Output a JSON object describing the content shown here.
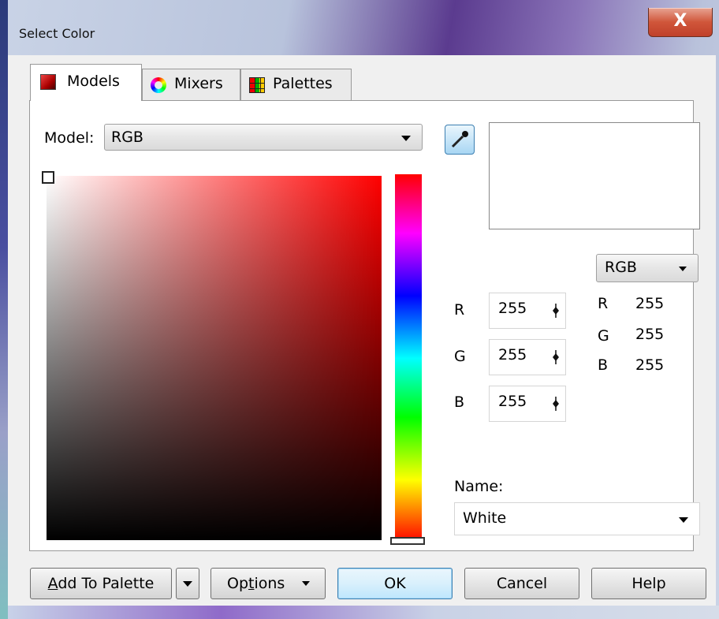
{
  "window": {
    "title": "Select Color",
    "close_glyph": "X"
  },
  "tabs": [
    {
      "label": "Models",
      "icon": "models-swatch-icon",
      "active": true
    },
    {
      "label": "Mixers",
      "icon": "mixers-ring-icon",
      "active": false
    },
    {
      "label": "Palettes",
      "icon": "palettes-grid-icon",
      "active": false
    }
  ],
  "model": {
    "label": "Model:",
    "value": "RGB"
  },
  "picker": {
    "hue": "red",
    "marker_icon": "crosshair-square-icon"
  },
  "eyedropper": {
    "icon": "eyedropper-icon"
  },
  "preview": {
    "color": "#ffffff"
  },
  "readout_model": {
    "value": "RGB"
  },
  "channels": [
    {
      "label": "R",
      "value": "255"
    },
    {
      "label": "G",
      "value": "255"
    },
    {
      "label": "B",
      "value": "255"
    }
  ],
  "readout": [
    {
      "label": "R",
      "value": "255"
    },
    {
      "label": "G",
      "value": "255"
    },
    {
      "label": "B",
      "value": "255"
    }
  ],
  "name": {
    "label": "Name:",
    "value": "White"
  },
  "buttons": {
    "add_to_palette_prefix": "A",
    "add_to_palette_rest": "dd To Palette",
    "options_prefix": "Op",
    "options_underlined": "t",
    "options_rest": "ions",
    "ok": "OK",
    "cancel": "Cancel",
    "help": "Help"
  },
  "colors": {
    "accent": "#3c7fb1",
    "close": "#c0402a",
    "hue_selected": "#ff0000"
  }
}
